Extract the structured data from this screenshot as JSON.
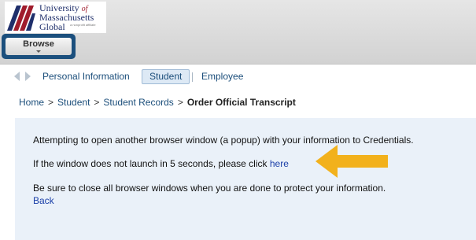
{
  "logo": {
    "line1": "University",
    "line1_of": "of",
    "line2": "Massachusetts",
    "line3": "Global",
    "sub": "a nonprofit affiliate"
  },
  "header": {
    "browse_label": "Browse"
  },
  "tabs": [
    {
      "label": "Personal Information",
      "active": false
    },
    {
      "label": "Student",
      "active": true
    },
    {
      "label": "Employee",
      "active": false
    }
  ],
  "breadcrumb": {
    "items": [
      "Home",
      "Student",
      "Student Records"
    ],
    "separator": ">",
    "current": "Order Official Transcript"
  },
  "panel": {
    "message1": "Attempting to open another browser window (a popup) with your information to Credentials.",
    "message2_prefix": "If the window does not launch in 5 seconds, please click",
    "message2_link": "here",
    "message3": "Be sure to close all browser windows when you are done to protect your information.",
    "back_label": "Back"
  },
  "colors": {
    "accent": "#1b4f7d",
    "link": "#1a3fa8",
    "panel_bg": "#eaf1f9",
    "callout_arrow": "#f2b11c"
  }
}
